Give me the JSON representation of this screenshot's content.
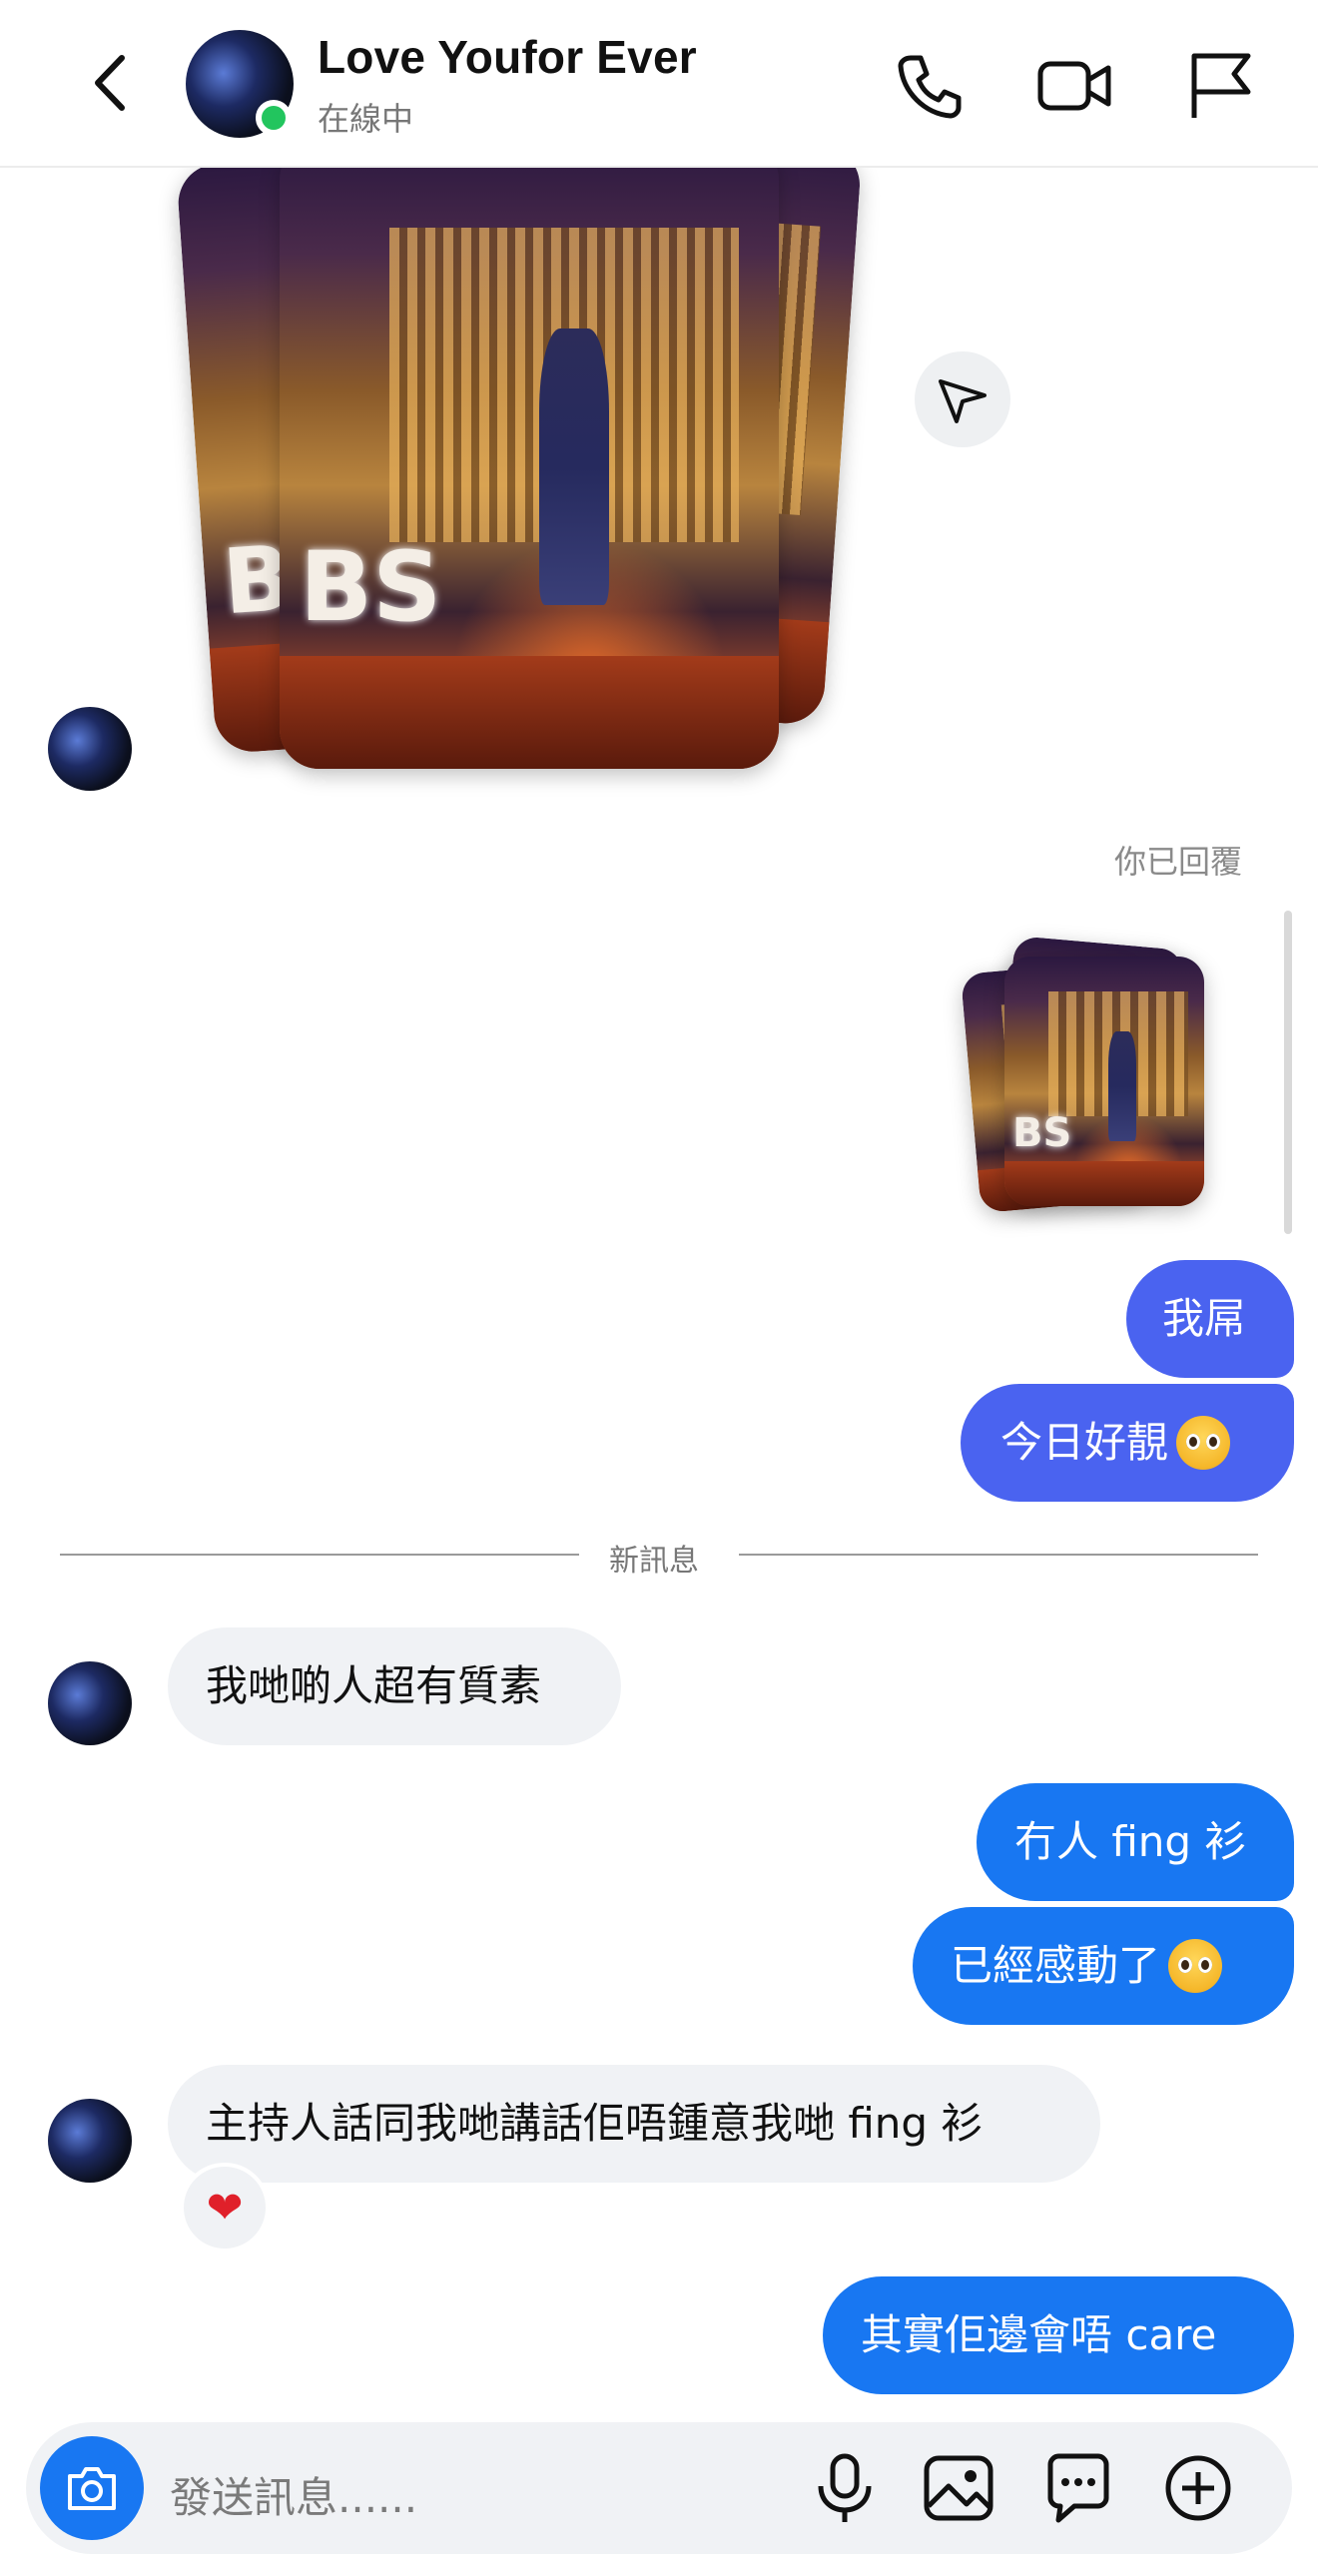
{
  "header": {
    "title": "Love Youfor Ever",
    "status": "在線中"
  },
  "thread": {
    "replied_label": "你已回覆",
    "divider_label": "新訊息",
    "outgoing_1": "我屌",
    "outgoing_2": "今日好靚",
    "incoming_1": "我哋啲人超有質素",
    "outgoing_3": "冇人 fing 衫",
    "outgoing_4": "已經感動了",
    "incoming_2": "主持人話同我哋講話佢唔鍾意我哋 fing 衫",
    "reaction": "❤",
    "outgoing_5": "其實佢邊會唔 care",
    "photo_sign_text": "BS"
  },
  "composer": {
    "placeholder": "發送訊息......"
  },
  "colors": {
    "accent": "#1877f2",
    "online": "#22c55e",
    "incoming_bubble": "#f0f2f5"
  },
  "icons": [
    "back-arrow-icon",
    "phone-icon",
    "video-icon",
    "flag-icon",
    "share-icon",
    "camera-icon",
    "microphone-icon",
    "gallery-icon",
    "sticker-icon",
    "plus-icon"
  ]
}
